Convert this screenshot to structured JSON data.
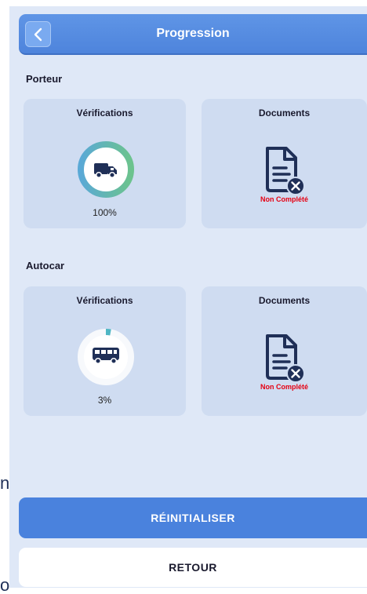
{
  "header": {
    "title": "Progression"
  },
  "sections": [
    {
      "title": "Porteur",
      "verifications": {
        "title": "Vérifications",
        "percent": "100%",
        "progress": 1.0,
        "vehicle_icon": "truck-icon"
      },
      "documents": {
        "title": "Documents",
        "status": "Non Complété",
        "icon": "document-cancel-icon"
      }
    },
    {
      "title": "Autocar",
      "verifications": {
        "title": "Vérifications",
        "percent": "3%",
        "progress": 0.03,
        "vehicle_icon": "bus-icon"
      },
      "documents": {
        "title": "Documents",
        "status": "Non Complété",
        "icon": "document-cancel-icon"
      }
    }
  ],
  "buttons": {
    "reset": "RÉINITIALISER",
    "back": "RETOUR"
  },
  "edge_glyphs": [
    "n",
    "o"
  ],
  "colors": {
    "header": "#5b8fe3",
    "primary_button": "#4a82dd",
    "card": "#cfdcf1",
    "ring_gradient_start": "#5aa9d6",
    "ring_gradient_end": "#6cc38e",
    "ring_progress_3": "#4fb6c4",
    "icon_navy": "#1f2f57",
    "status_red": "#e60012"
  }
}
